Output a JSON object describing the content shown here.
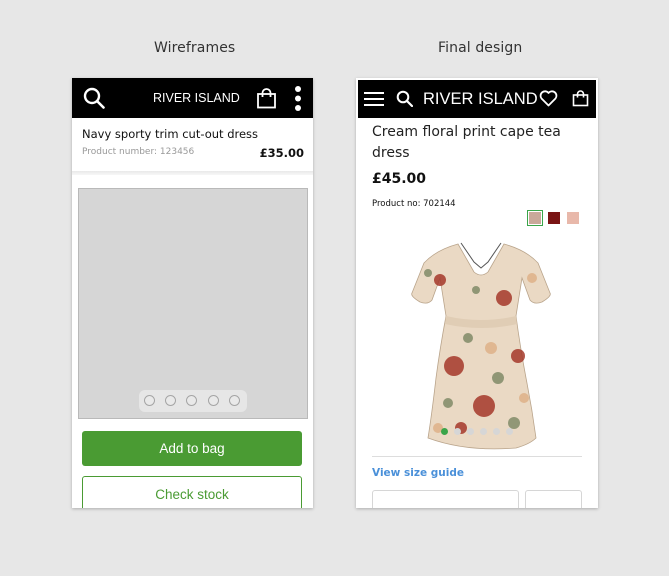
{
  "captions": {
    "wireframes": "Wireframes",
    "final": "Final design"
  },
  "wireframe": {
    "brand": "RIVER ISLAND",
    "product_title": "Navy sporty trim cut-out dress",
    "product_number": "Product number: 123456",
    "price": "£35.00",
    "carousel_dots": 5,
    "add_to_bag": "Add to bag",
    "check_stock": "Check stock",
    "colors": {
      "header": "#000000",
      "primary": "#4a9b33"
    }
  },
  "final": {
    "brand": "RIVER ISLAND",
    "product_title": "Cream floral print cape tea dress",
    "price": "£45.00",
    "product_no": "Product no: 702144",
    "swatches": [
      "#c9a99a",
      "#7a1414",
      "#e8b8aa"
    ],
    "selected_swatch": 0,
    "size_guide": "View size guide",
    "colors": {
      "header": "#000000",
      "accent": "#3aa54a",
      "link": "#4a90d9"
    }
  }
}
